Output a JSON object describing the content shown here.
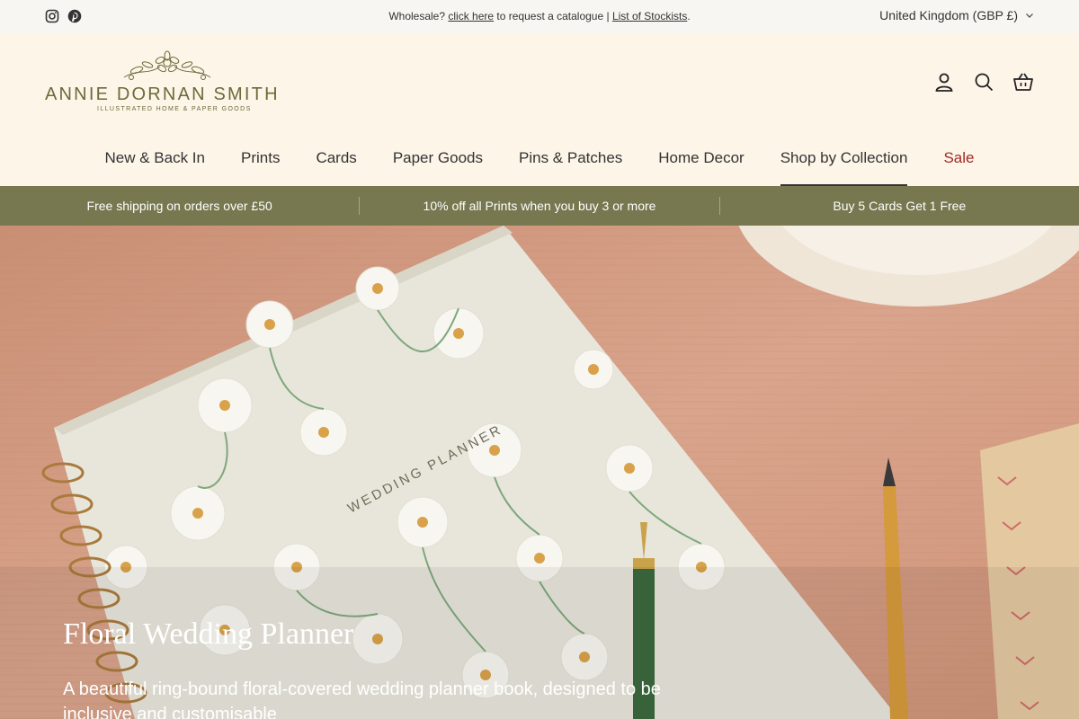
{
  "topbar": {
    "social": [
      "instagram-icon",
      "pinterest-icon"
    ],
    "announcement": {
      "prefix": "Wholesale?",
      "link1": "click here",
      "middle": "to request a catalogue |",
      "link2": "List of Stockists",
      "suffix": "."
    },
    "locale": "United Kingdom (GBP £)"
  },
  "header": {
    "logo": {
      "name": "ANNIE DORNAN SMITH",
      "tagline": "ILLUSTRATED HOME & PAPER GOODS"
    },
    "icons": [
      "account-icon",
      "search-icon",
      "basket-icon"
    ]
  },
  "nav": {
    "items": [
      {
        "label": "New & Back In"
      },
      {
        "label": "Prints"
      },
      {
        "label": "Cards"
      },
      {
        "label": "Paper Goods"
      },
      {
        "label": "Pins & Patches"
      },
      {
        "label": "Home Decor"
      },
      {
        "label": "Shop by Collection",
        "active": true
      },
      {
        "label": "Sale"
      }
    ]
  },
  "promo": {
    "items": [
      "Free shipping on orders over £50",
      "10% off all Prints when you buy 3 or more",
      "Buy 5 Cards Get 1 Free"
    ]
  },
  "hero": {
    "title": "Floral Wedding Planner",
    "text": "A beautiful ring-bound floral-covered wedding planner book, designed to be inclusive and customisable",
    "planner_label": "WEDDING PLANNER"
  },
  "colors": {
    "background": "#fdf5e8",
    "promo": "#77784f",
    "sale": "#a12a24",
    "logo": "#6b6b3a"
  }
}
